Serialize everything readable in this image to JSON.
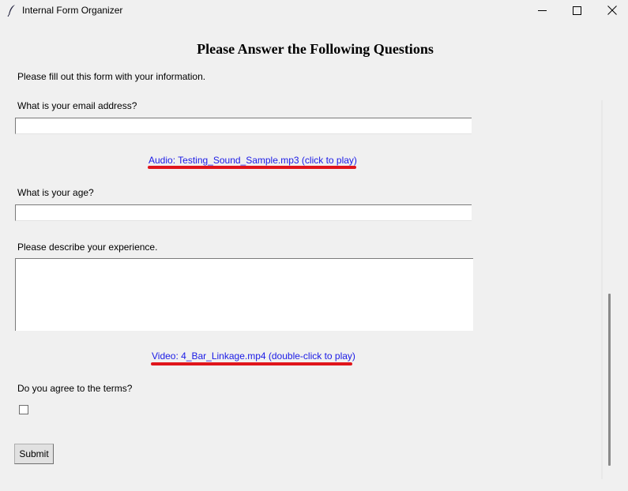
{
  "window": {
    "title": "Internal Form Organizer",
    "controls": {
      "minimize_icon": "minimize-icon",
      "maximize_icon": "maximize-icon",
      "close_icon": "close-icon"
    }
  },
  "form": {
    "heading": "Please Answer the Following Questions",
    "intro": "Please fill out this form with your information.",
    "email": {
      "label": "What is your email address?",
      "value": "",
      "placeholder": ""
    },
    "audio_link": {
      "text": "Audio: Testing_Sound_Sample.mp3 (click to play)",
      "color": "#1a1ae6",
      "underline_color": "#e0151b"
    },
    "age": {
      "label": "What is your age?",
      "value": "",
      "placeholder": ""
    },
    "experience": {
      "label": "Please describe your experience.",
      "value": ""
    },
    "video_link": {
      "text": "Video: 4_Bar_Linkage.mp4 (double-click to play)",
      "color": "#1a1ae6",
      "underline_color": "#e0151b"
    },
    "terms": {
      "label": "Do you agree to the terms?",
      "checked": false
    },
    "submit_label": "Submit"
  }
}
